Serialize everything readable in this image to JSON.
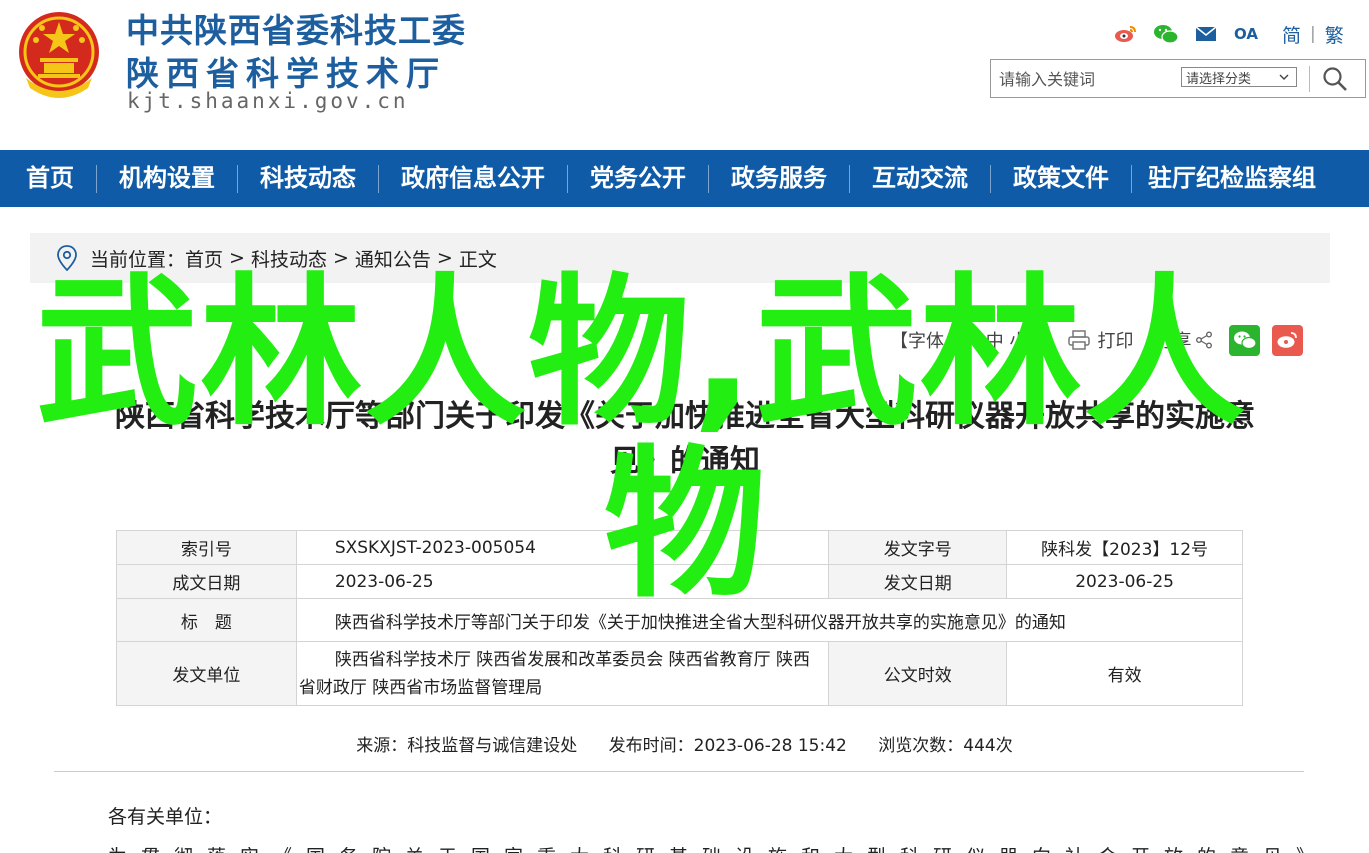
{
  "header": {
    "org_line1": "中共陕西省委科技工委",
    "org_line2": "陕西省科学技术厅",
    "domain": "kjt.shaanxi.gov.cn",
    "lang_simplified": "简",
    "lang_traditional": "繁",
    "tool_icons": [
      "weibo-icon",
      "wechat-icon",
      "mail-icon",
      "oa-icon"
    ],
    "oa_label": "OA"
  },
  "search": {
    "placeholder": "请输入关键词",
    "category_selected": "请选择分类"
  },
  "nav": {
    "items": [
      "首页",
      "机构设置",
      "科技动态",
      "政府信息公开",
      "党务公开",
      "政务服务",
      "互动交流",
      "政策文件",
      "驻厅纪检监察组"
    ]
  },
  "breadcrumb": {
    "label": "当前位置：",
    "items": [
      "首页",
      "科技动态",
      "通知公告",
      "正文"
    ],
    "separator": ">"
  },
  "article_tools": {
    "font_size": "【字体：大 中 小】",
    "print": "打印",
    "share": "分享"
  },
  "watermark": {
    "line1": "武林人物,武林人",
    "line2": "物"
  },
  "article": {
    "title_line1": "陕西省科学技术厅等部门关于印发《关于加快推进全省大型科研仪器开放共享的实施意",
    "title_line2": "见》的通知"
  },
  "info_table": {
    "index_label": "索引号",
    "index_value": "SXSKXJST-2023-005054",
    "doc_no_label": "发文字号",
    "doc_no_value": "陕科发【2023】12号",
    "created_label": "成文日期",
    "created_value": "2023-06-25",
    "issued_label": "发文日期",
    "issued_value": "2023-06-25",
    "title_label": "标　题",
    "title_value": "陕西省科学技术厅等部门关于印发《关于加快推进全省大型科研仪器开放共享的实施意见》的通知",
    "issuer_label": "发文单位",
    "issuer_value_line1": "陕西省科学技术厅 陕西省发展和改革委员会 陕西省教育厅 陕西",
    "issuer_value_line2": "省财政厅 陕西省市场监督管理局",
    "validity_label": "公文时效",
    "validity_value": "有效"
  },
  "meta": {
    "source": "来源：科技监督与诚信建设处",
    "published": "发布时间：2023-06-28 15:42",
    "views": "浏览次数：444次"
  },
  "body": {
    "salutation": "各有关单位：",
    "para1_partial": "为贯彻落实《国务院关于国家重大科研基础设施和大型科研仪器向社会开放的意见》"
  },
  "colors": {
    "brand_blue": "#1d5e9f",
    "nav_blue": "#0f5ba7",
    "watermark_green": "#22ee11",
    "wechat_green": "#2bb42e",
    "weibo_red": "#e9594e"
  }
}
